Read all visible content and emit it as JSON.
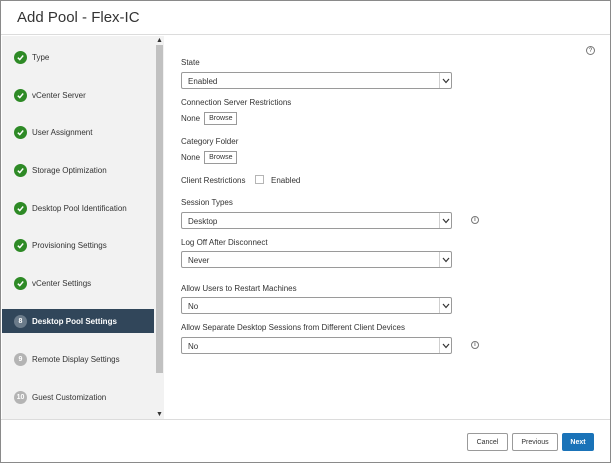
{
  "header": {
    "title": "Add Pool - Flex-IC"
  },
  "colors": {
    "done": "#2e8a26",
    "active_bg": "#31465a",
    "primary": "#1a73b8"
  },
  "steps": [
    {
      "marker": "check-icon",
      "label": "Type",
      "state": "done"
    },
    {
      "marker": "check-icon",
      "label": "vCenter Server",
      "state": "done"
    },
    {
      "marker": "check-icon",
      "label": "User Assignment",
      "state": "done"
    },
    {
      "marker": "check-icon",
      "label": "Storage Optimization",
      "state": "done"
    },
    {
      "marker": "check-icon",
      "label": "Desktop Pool Identification",
      "state": "done"
    },
    {
      "marker": "check-icon",
      "label": "Provisioning Settings",
      "state": "done"
    },
    {
      "marker": "check-icon",
      "label": "vCenter Settings",
      "state": "done"
    },
    {
      "marker": "8",
      "label": "Desktop Pool Settings",
      "state": "active"
    },
    {
      "marker": "9",
      "label": "Remote Display Settings",
      "state": "pending"
    },
    {
      "marker": "10",
      "label": "Guest Customization",
      "state": "pending"
    }
  ],
  "form": {
    "help_icon": "?",
    "state": {
      "label": "State",
      "value": "Enabled"
    },
    "conn_restrictions": {
      "label": "Connection Server Restrictions",
      "value": "None",
      "button": "Browse"
    },
    "category_folder": {
      "label": "Category Folder",
      "value": "None",
      "button": "Browse"
    },
    "client_restrictions": {
      "label": "Client Restrictions",
      "checkbox_label": "Enabled",
      "checked": false
    },
    "session_types": {
      "label": "Session Types",
      "value": "Desktop"
    },
    "log_off": {
      "label": "Log Off After Disconnect",
      "value": "Never"
    },
    "allow_restart": {
      "label": "Allow Users to Restart Machines",
      "value": "No"
    },
    "separate_sessions": {
      "label": "Allow Separate Desktop Sessions from Different Client Devices",
      "value": "No"
    }
  },
  "footer": {
    "cancel": "Cancel",
    "previous": "Previous",
    "next": "Next"
  }
}
